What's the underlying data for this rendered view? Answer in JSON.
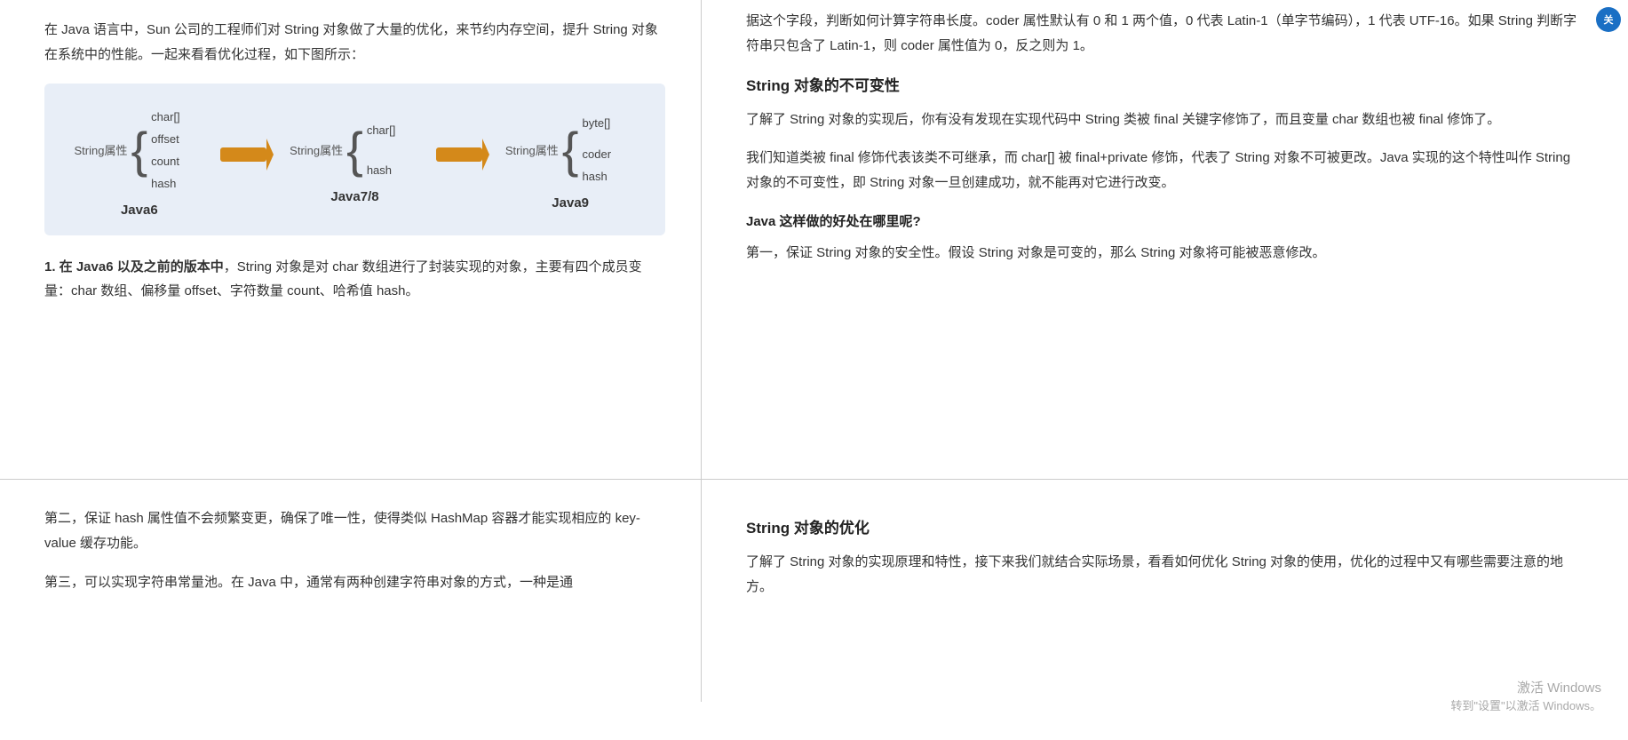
{
  "left_top": {
    "intro": "在 Java 语言中，Sun 公司的工程师们对 String 对象做了大量的优化，来节约内存空间，提升 String 对象在系统中的性能。一起来看看优化过程，如下图所示：",
    "diagram": {
      "java6": {
        "label": "Java6",
        "struct_label": "String属性",
        "fields": [
          "char[]",
          "offset",
          "count",
          "hash"
        ]
      },
      "java78": {
        "label": "Java7/8",
        "struct_label": "String属性",
        "fields": [
          "char[]",
          "hash"
        ]
      },
      "java9": {
        "label": "Java9",
        "struct_label": "String属性",
        "fields": [
          "byte[]",
          "coder",
          "hash"
        ]
      }
    },
    "point1": "1. 在 Java6 以及之前的版本中，String 对象是对 char 数组进行了封装实现的对象，主要有四个成员变量：char 数组、偏移量 offset、字符数量 count、哈希值 hash。"
  },
  "right_top": {
    "coder_intro": "据这个字段，判断如何计算字符串长度。coder 属性默认有 0 和 1 两个值，0 代表 Latin-1（单字节编码），1 代表 UTF-16。如果 String 判断字符串只包含了 Latin-1，则 coder 属性值为 0，反之则为 1。",
    "immutability_heading": "String 对象的不可变性",
    "immutability_p1": "了解了 String 对象的实现后，你有没有发现在实现代码中 String 类被 final 关键字修饰了，而且变量 char 数组也被 final 修饰了。",
    "immutability_p2": "我们知道类被 final 修饰代表该类不可继承，而 char[] 被 final+private 修饰，代表了 String 对象不可被更改。Java 实现的这个特性叫作 String 对象的不可变性，即 String 对象一旦创建成功，就不能再对它进行改变。",
    "benefit_heading": "Java 这样做的好处在哪里呢?",
    "benefit_p1": "第一，保证 String 对象的安全性。假设 String 对象是可变的，那么 String 对象将可能被恶意修改。"
  },
  "left_bottom": {
    "p2": "第二，保证 hash 属性值不会频繁变更，确保了唯一性，使得类似 HashMap 容器才能实现相应的 key-value 缓存功能。",
    "p3": "第三，可以实现字符串常量池。在 Java 中，通常有两种创建字符串对象的方式，一种是通"
  },
  "right_bottom": {
    "optimization_heading": "String 对象的优化",
    "optimization_p1": "了解了 String 对象的实现原理和特性，接下来我们就结合实际场景，看看如何优化 String 对象的使用，优化的过程中又有哪些需要注意的地方。"
  },
  "watermark": {
    "line1": "激活 Windows",
    "line2": "转到\"设置\"以激活 Windows。"
  },
  "badge": {
    "text": "关"
  }
}
